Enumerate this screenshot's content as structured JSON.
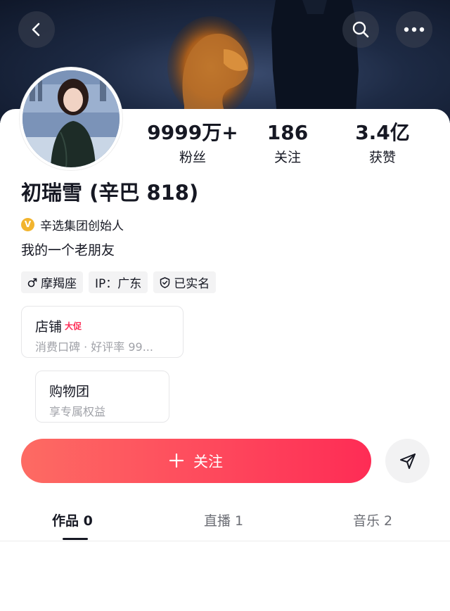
{
  "header": {
    "back_icon": "chevron-left-icon",
    "search_icon": "search-icon",
    "more_icon": "more-horizontal-icon"
  },
  "stats": [
    {
      "value": "9999万+",
      "label": "粉丝"
    },
    {
      "value": "186",
      "label": "关注"
    },
    {
      "value": "3.4亿",
      "label": "获赞"
    }
  ],
  "profile": {
    "name": "初瑞雪 (辛巴 818)",
    "verified_badge": "V",
    "verified_text": "辛选集团创始人",
    "bio": "我的一个老朋友"
  },
  "tags": [
    {
      "icon": "male-icon",
      "label": "摩羯座"
    },
    {
      "icon": "",
      "label": "IP：广东"
    },
    {
      "icon": "shield-check-icon",
      "label": "已实名"
    }
  ],
  "shop": {
    "title": "店铺",
    "badge": "大促",
    "subtitle": "消费口碑 · 好评率 99..."
  },
  "group": {
    "title": "购物团",
    "subtitle": "享专属权益"
  },
  "actions": {
    "follow_label": "关注",
    "follow_icon": "plus-icon",
    "share_icon": "send-icon"
  },
  "tabs": [
    {
      "label": "作品 0",
      "active": true
    },
    {
      "label": "直播 1",
      "active": false
    },
    {
      "label": "音乐 2",
      "active": false
    }
  ],
  "colors": {
    "accent": "#fe2c55",
    "verified": "#f2b42e"
  }
}
